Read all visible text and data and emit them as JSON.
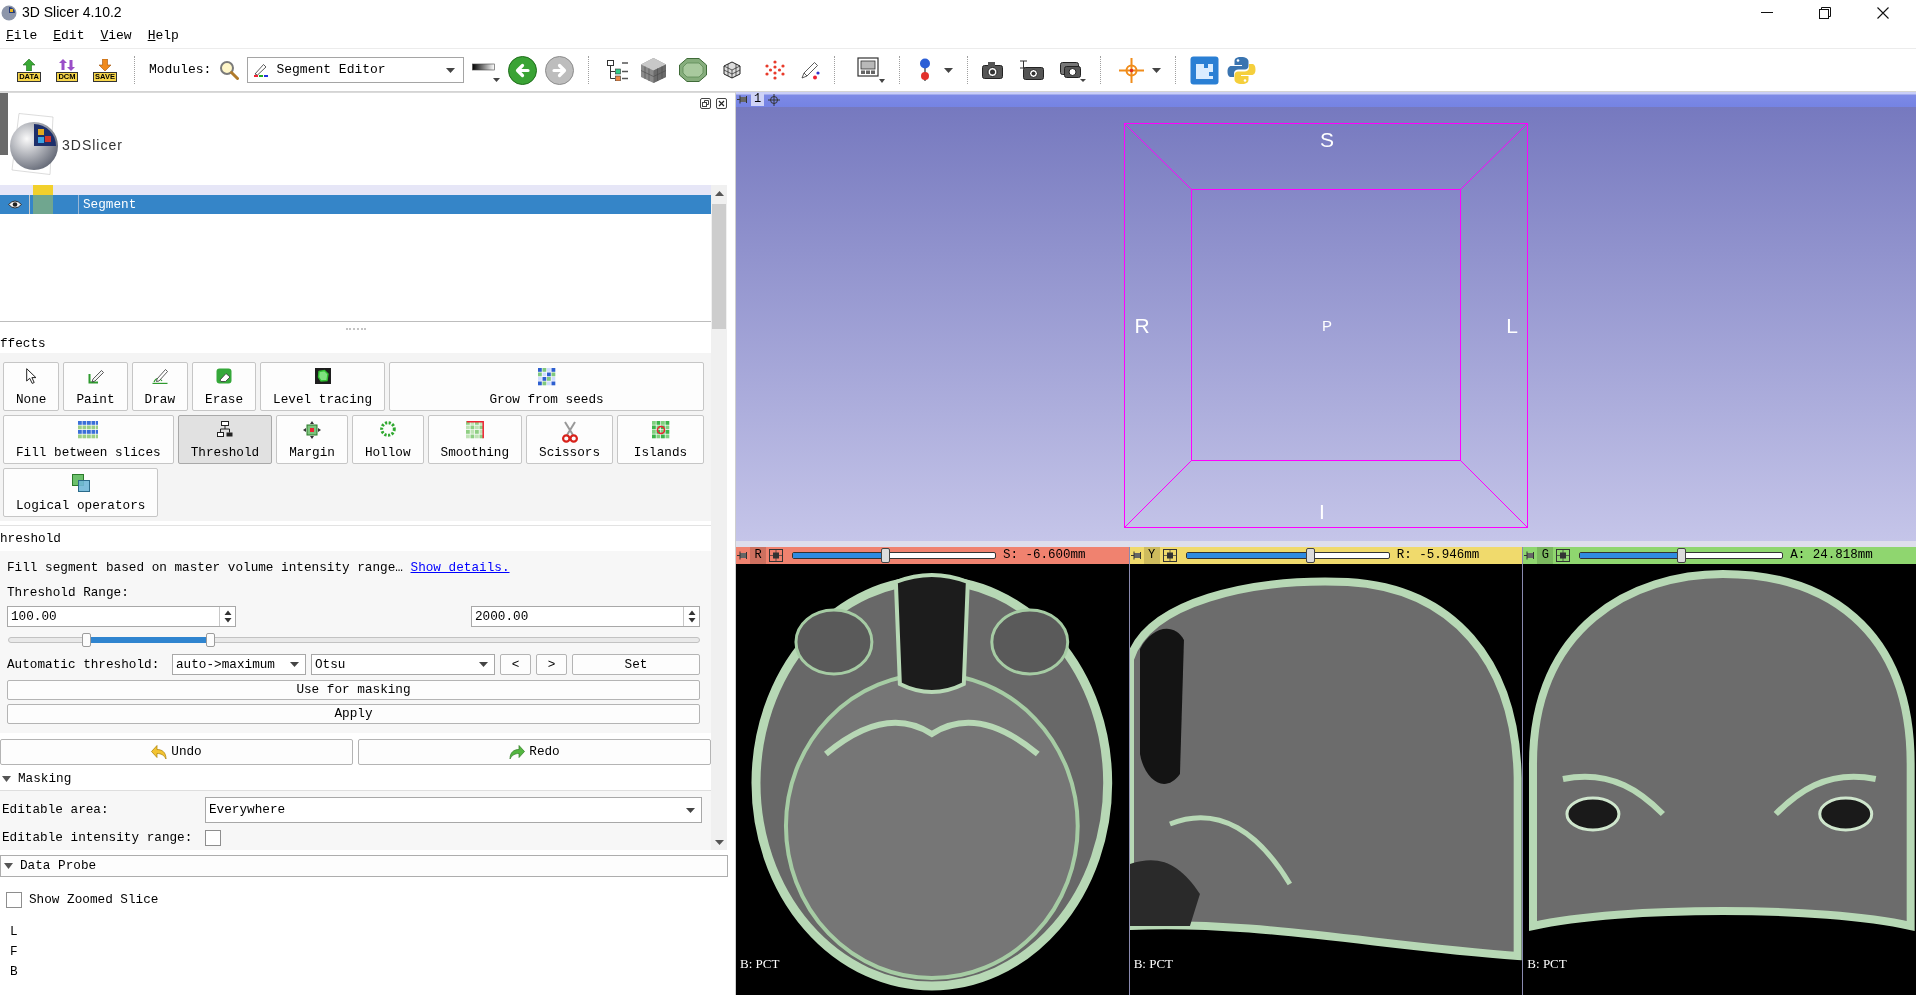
{
  "window": {
    "title": "3D Slicer 4.10.2"
  },
  "menu": [
    {
      "label": "File"
    },
    {
      "label": "Edit"
    },
    {
      "label": "View"
    },
    {
      "label": "Help"
    }
  ],
  "toolbar": {
    "file_buttons": [
      {
        "label": "DATA"
      },
      {
        "label": "DCM"
      },
      {
        "label": "SAVE"
      }
    ],
    "modules_label": "Modules:",
    "module": "Segment Editor",
    "navigation": [
      {
        "disabled": false
      },
      {
        "disabled": true
      }
    ]
  },
  "module_panel": {
    "logo_text": "3DSlicer",
    "segments": [
      {
        "color": "#f2d02c",
        "selected": false
      },
      {
        "name": "Segment",
        "color": "#70a68f",
        "selected": true
      }
    ],
    "effects_title": "ffects",
    "effect_rows": [
      [
        {
          "label": "None",
          "selected": false
        },
        {
          "label": "Paint",
          "selected": false
        },
        {
          "label": "Draw",
          "selected": false
        },
        {
          "label": "Erase",
          "selected": false
        },
        {
          "label": "Level tracing",
          "selected": false
        },
        {
          "label": "Grow from seeds",
          "selected": false
        }
      ],
      [
        {
          "label": "Fill between slices",
          "selected": false
        },
        {
          "label": "Threshold",
          "selected": true
        },
        {
          "label": "Margin",
          "selected": false
        },
        {
          "label": "Hollow",
          "selected": false
        },
        {
          "label": "Smoothing",
          "selected": false
        },
        {
          "label": "Scissors",
          "selected": false
        },
        {
          "label": "Islands",
          "selected": false
        }
      ],
      [
        {
          "label": "Logical operators",
          "selected": false
        }
      ]
    ],
    "threshold": {
      "title": "hreshold",
      "description": "Fill segment based on master volume intensity range…",
      "details_link": "Show details.",
      "range_label": "Threshold Range:",
      "min_value": "100.00",
      "max_value": "2000.00",
      "range_handles": [
        {
          "level": 0.113
        },
        {
          "level": 0.293
        }
      ],
      "auto_label": "Automatic threshold:",
      "auto_mode": "auto->maximum",
      "auto_method": "Otsu",
      "step_buttons": [
        "<",
        ">"
      ],
      "set_button": "Set",
      "use_for_masking": "Use for masking",
      "apply": "Apply"
    },
    "undo": "Undo",
    "redo": "Redo",
    "masking": {
      "title": "Masking",
      "expanded": true,
      "editable_area_label": "Editable area:",
      "editable_area": "Everywhere",
      "intensity_label": "Editable intensity range:",
      "intensity_checked": false
    }
  },
  "data_probe": {
    "title": "Data Probe",
    "expanded": true,
    "show_zoomed_label": "Show Zoomed Slice",
    "show_zoomed_checked": false,
    "info_lines": [
      "L",
      "F",
      "B"
    ]
  },
  "view_3d": {
    "view_label": "1",
    "orientation": {
      "top": "S",
      "left": "R",
      "center": "P",
      "right": "L",
      "bottom": "I"
    }
  },
  "slice_views": [
    {
      "name": "R",
      "color": "#f0826f",
      "level": 0.456,
      "offset": "S: -6.600mm",
      "volume": "B: PCT"
    },
    {
      "name": "Y",
      "color": "#f0da6c",
      "level": 0.61,
      "offset": "R: -5.946mm",
      "volume": "B: PCT"
    },
    {
      "name": "G",
      "color": "#8fd66f",
      "level": 0.5,
      "offset": "A: 24.818mm",
      "volume": "B: PCT"
    }
  ]
}
